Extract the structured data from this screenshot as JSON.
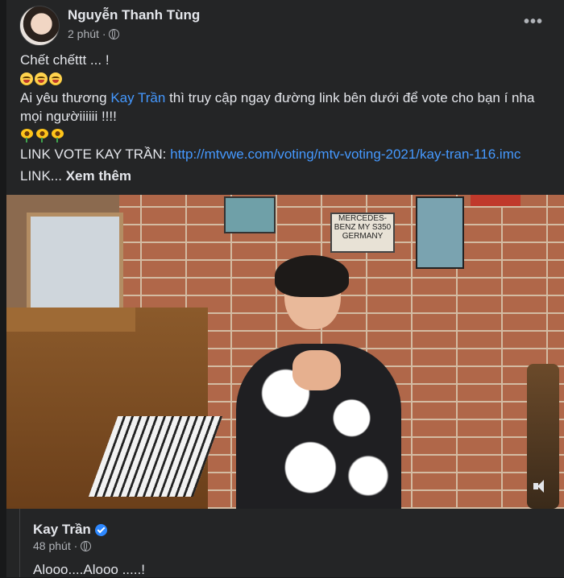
{
  "post": {
    "author": "Nguyễn Thanh Tùng",
    "time": "2 phút ·",
    "more_label": "•••",
    "line1": "Chết chếttt ... !",
    "line2_prefix": "Ai yêu thương ",
    "mention": "Kay Trần",
    "line2_suffix": " thì truy cập ngay đường link bên dưới để vote cho bạn í nha",
    "line3": "mọi ngườiiiiii !!!!",
    "link_label": "LINK VOTE KAY TRẦN: ",
    "link_url": "http://mtvwe.com/voting/mtv-voting-2021/kay-tran-116.imc",
    "truncated_prefix": "LINK... ",
    "see_more": "Xem thêm",
    "emoji_laugh_icon": "grinning-squinting-tongue-emoji",
    "emoji_flower_icon": "sunflower-emoji"
  },
  "media": {
    "sign_text": "MERCEDES-BENZ MY S350 GERMANY",
    "volume_icon": "volume-icon"
  },
  "shared": {
    "author": "Kay Trần",
    "time": "48 phút ·",
    "text": "Alooo....Alooo .....!"
  }
}
